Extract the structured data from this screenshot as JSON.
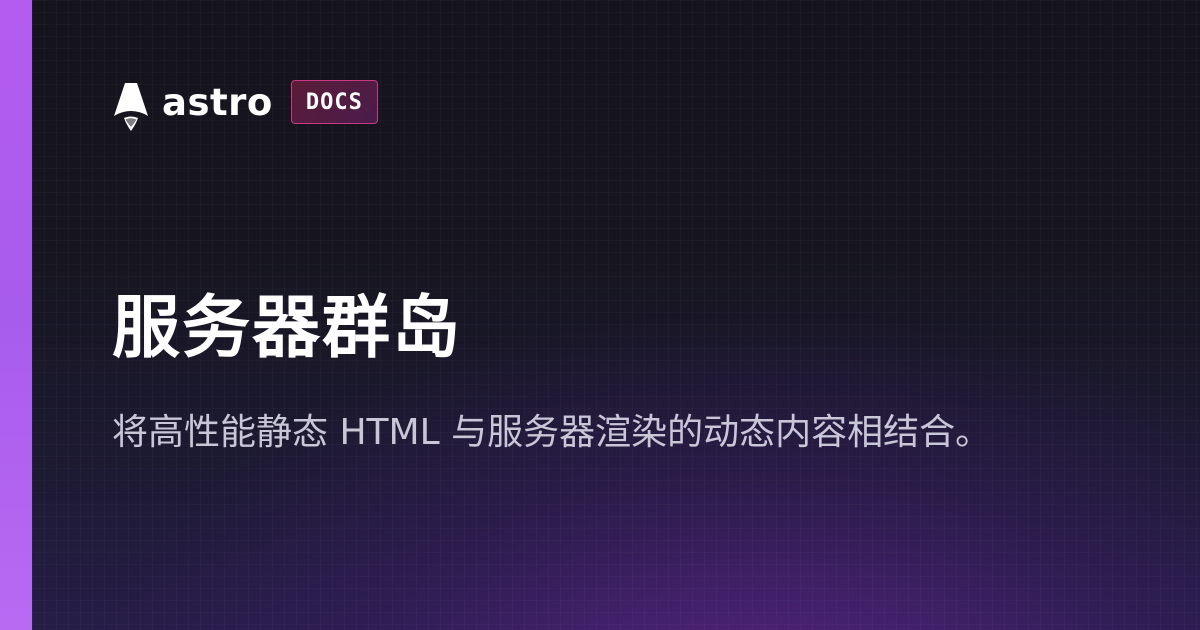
{
  "brand": {
    "logo_icon": "astro-rocket-icon",
    "wordmark": "astro",
    "badge_label": "DOCS"
  },
  "page": {
    "title": "服务器群岛",
    "description": "将高性能静态 HTML 与服务器渲染的动态内容相结合。"
  },
  "colors": {
    "accent_bar": "#b45cf0",
    "badge_border": "#c83a84",
    "background": "#13121b",
    "glow": "#6b2aa8",
    "title_text": "#ffffff",
    "description_text": "#c9c6d8"
  }
}
